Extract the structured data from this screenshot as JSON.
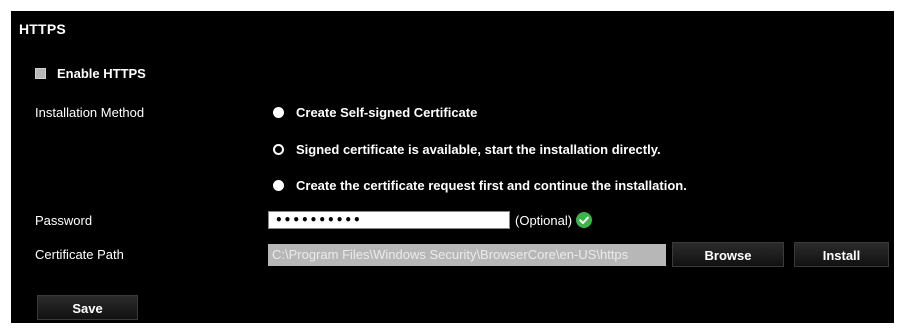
{
  "section": {
    "title": "HTTPS"
  },
  "enable_https": {
    "label": "Enable HTTPS",
    "checked": false
  },
  "installation_method": {
    "label": "Installation Method",
    "options": [
      {
        "label": "Create Self-signed Certificate",
        "selected": false
      },
      {
        "label": "Signed certificate is available, start the installation directly.",
        "selected": true
      },
      {
        "label": "Create the certificate request first and continue the installation.",
        "selected": false
      }
    ]
  },
  "password": {
    "label": "Password",
    "value": "••••••••••",
    "hint": "(Optional)",
    "status_icon": "check-circle-icon",
    "status_color": "#3cb44a"
  },
  "certificate_path": {
    "label": "Certificate Path",
    "value": "C:\\Program Files\\Windows Security\\BrowserCore\\en-US\\https",
    "browse_label": "Browse",
    "install_label": "Install"
  },
  "actions": {
    "save_label": "Save"
  }
}
